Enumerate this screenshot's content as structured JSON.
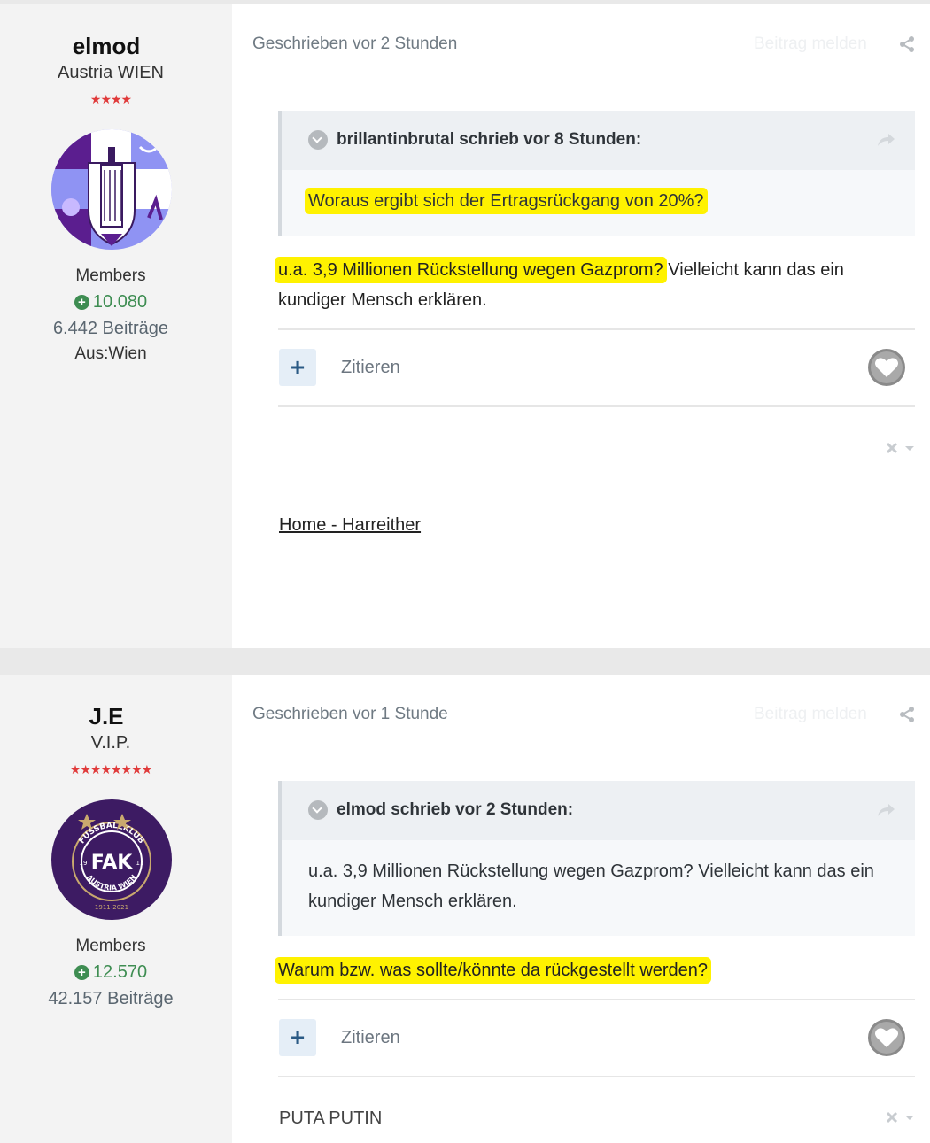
{
  "posts": [
    {
      "author": {
        "name": "elmod",
        "title": "Austria WIEN",
        "stars": "★★★★",
        "group": "Members",
        "reputation": "10.080",
        "post_count": "6.442 Beiträge",
        "location": "Aus:Wien"
      },
      "date": "Geschrieben vor 2 Stunden",
      "report": "Beitrag melden",
      "quote": {
        "title": "brillantinbrutal schrieb vor 8 Stunden:",
        "text": "Woraus ergibt sich der Ertragsrückgang von 20%?"
      },
      "body": {
        "highlighted": "u.a. 3,9 Millionen  Rückstellung wegen Gazprom?",
        "rest": " Vielleicht kann das ein kundiger Mensch erklären."
      },
      "cite_label": "Zitieren",
      "signature_link": "Home - Harreither"
    },
    {
      "author": {
        "name": "J.E",
        "title": "V.I.P.",
        "stars": "★★★★★★★★",
        "group": "Members",
        "reputation": "12.570",
        "post_count": "42.157 Beiträge"
      },
      "date": "Geschrieben vor 1 Stunde",
      "report": "Beitrag melden",
      "quote": {
        "title": "elmod schrieb vor 2 Stunden:",
        "text": "u.a. 3,9 Millionen  Rückstellung wegen Gazprom? Vielleicht kann das ein kundiger Mensch erklären."
      },
      "body": {
        "highlighted": "Warum bzw. was sollte/könnte da rückgestellt werden?"
      },
      "cite_label": "Zitieren",
      "signature_text": "PUTA PUTIN"
    }
  ],
  "avatar2": {
    "ring_text": "FUSSBALLKLUB",
    "ring_text_bottom": "AUSTRIA WIEN",
    "monogram": "FAK",
    "num_left": "19",
    "num_right": "11",
    "years": "1911-2021"
  },
  "colors": {
    "highlight": "#fff200",
    "reputation": "#3e8d52",
    "stars": "#e03a3a"
  },
  "icons": [
    "share-icon",
    "quote-toggle-icon",
    "quote-link-icon",
    "heart-icon",
    "moderation-icon",
    "plus-icon"
  ]
}
